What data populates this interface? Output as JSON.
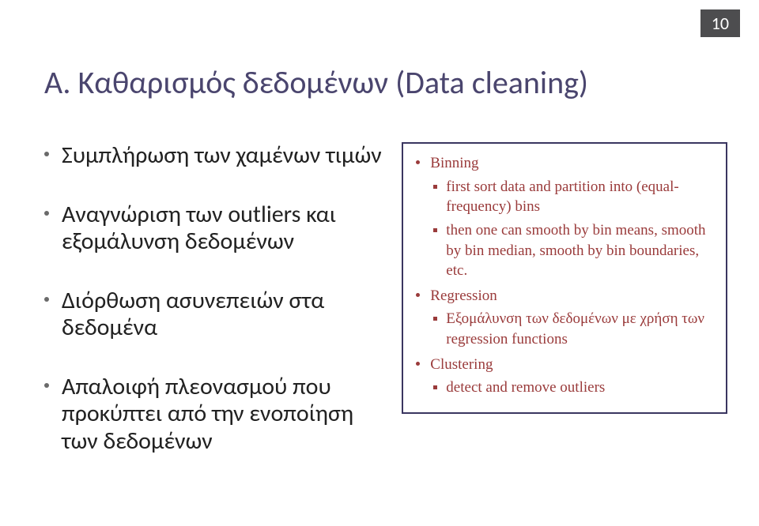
{
  "page_number": "10",
  "title": "Α. Καθαρισμός δεδομένων (Data cleaning)",
  "left": {
    "items": [
      "Συμπλήρωση των χαμένων τιμών",
      "Αναγνώριση των outliers και εξομάλυνση δεδομένων",
      "Διόρθωση ασυνεπειών στα δεδομένα",
      "Απαλοιφή πλεονασμού που προκύπτει από την ενοποίηση των δεδομένων"
    ]
  },
  "right": {
    "binning": {
      "label": "Binning",
      "sub1": "first sort data and partition into (equal-frequency) bins",
      "sub2": "then one can smooth by bin means, smooth by bin median, smooth by bin boundaries, etc."
    },
    "regression": {
      "label": "Regression",
      "sub1": "Εξομάλυνση των δεδομένων με χρήση των regression functions"
    },
    "clustering": {
      "label": "Clustering",
      "sub1": "detect and remove outliers"
    }
  }
}
